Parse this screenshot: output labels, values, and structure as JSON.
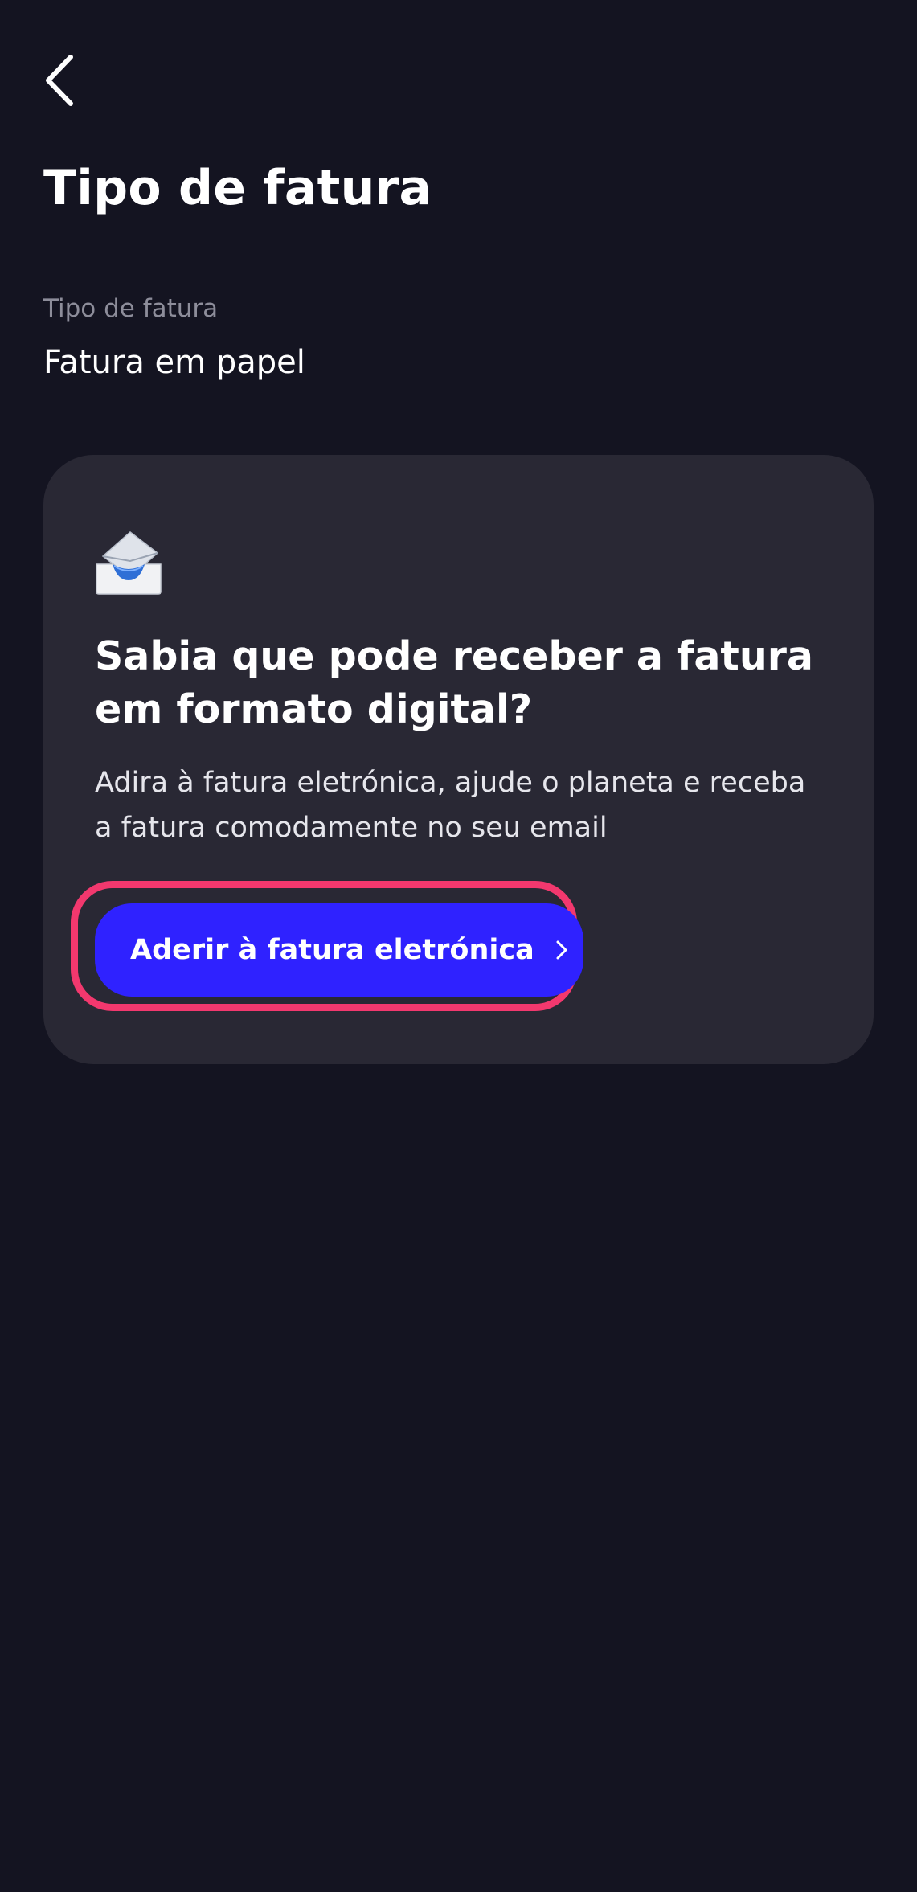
{
  "header": {
    "back_icon": "chevron-left-icon",
    "title": "Tipo de fatura"
  },
  "invoice_type": {
    "label": "Tipo de fatura",
    "value": "Fatura em papel"
  },
  "promo": {
    "icon": "incoming-envelope-icon",
    "heading": "Sabia que pode receber a fatura em formato digital?",
    "body": "Adira à fatura eletrónica, ajude o planeta e receba a fatura comodamente no seu email",
    "cta_label": "Aderir à fatura eletrónica",
    "cta_icon": "chevron-right-icon"
  },
  "colors": {
    "background": "#141421",
    "card": "#292834",
    "cta": "#2f22ff",
    "highlight": "#f2386e",
    "muted_text": "#8d8d9a"
  }
}
